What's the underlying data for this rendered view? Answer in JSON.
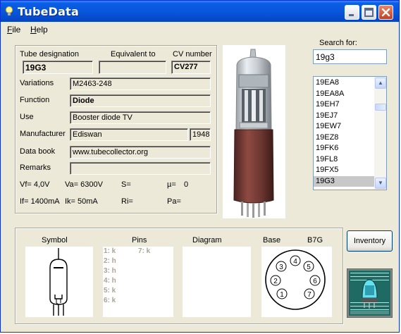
{
  "window": {
    "title": "TubeData"
  },
  "menu": {
    "file": "File",
    "help": "Help"
  },
  "search": {
    "label": "Search for:",
    "value": "19g3"
  },
  "tube_list": {
    "items": [
      "19EA8",
      "19EA8A",
      "19EH7",
      "19EJ7",
      "19EW7",
      "19EZ8",
      "19FK6",
      "19FL8",
      "19FX5",
      "19G3"
    ],
    "selected": "19G3"
  },
  "details": {
    "designation_label": "Tube designation",
    "designation": "19G3",
    "equivalent_label": "Equivalent to",
    "equivalent": "",
    "cv_label": "CV number",
    "cv": "CV277",
    "variations_label": "Variations",
    "variations": "M2463-248",
    "function_label": "Function",
    "function": "Diode",
    "use_label": "Use",
    "use": "Booster diode TV",
    "manufacturer_label": "Manufacturer",
    "manufacturer": "Ediswan",
    "year": "1948",
    "databook_label": "Data book",
    "databook": "www.tubecollector.org",
    "remarks_label": "Remarks",
    "remarks": ""
  },
  "specs": {
    "vf": "Vf= 4,0V",
    "va": "Va= 6300V",
    "s": "S=",
    "mu_label": "µ=",
    "mu": "0",
    "if": "If= 1400mA",
    "ik": "Ik=  50mA",
    "ri": "Ri=",
    "pa": "Pa="
  },
  "bottom": {
    "symbol_label": "Symbol",
    "pins_label": "Pins",
    "diagram_label": "Diagram",
    "base_label": "Base",
    "base_type": "B7G",
    "pins_col1": [
      "1: k",
      "2: h",
      "3: h",
      "4: h",
      "5: k",
      "6: k"
    ],
    "pins_col2": [
      "7: k"
    ],
    "base_pins": [
      "1",
      "2",
      "3",
      "4",
      "5",
      "6",
      "7"
    ]
  },
  "inventory_button": "Inventory",
  "colors": {
    "title_bar": "#0754d8",
    "face": "#ece9d8",
    "list_selected": "#c8c8c8",
    "close_button": "#c24121"
  },
  "icons": [
    "lightbulb-icon",
    "minimize-icon",
    "maximize-icon",
    "close-icon",
    "scroll-up-icon",
    "scroll-down-icon",
    "tube-photo",
    "tube-symbol",
    "base-diagram",
    "logo-image"
  ]
}
